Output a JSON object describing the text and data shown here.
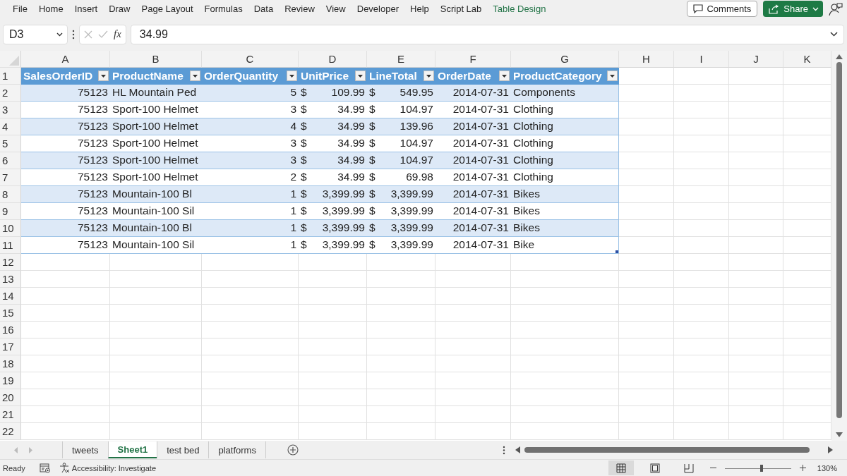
{
  "ribbon_tabs": [
    {
      "label": "File",
      "kind": "normal"
    },
    {
      "label": "Home",
      "kind": "normal"
    },
    {
      "label": "Insert",
      "kind": "normal"
    },
    {
      "label": "Draw",
      "kind": "normal"
    },
    {
      "label": "Page Layout",
      "kind": "normal"
    },
    {
      "label": "Formulas",
      "kind": "normal"
    },
    {
      "label": "Data",
      "kind": "normal"
    },
    {
      "label": "Review",
      "kind": "normal"
    },
    {
      "label": "View",
      "kind": "normal"
    },
    {
      "label": "Developer",
      "kind": "normal"
    },
    {
      "label": "Help",
      "kind": "normal"
    },
    {
      "label": "Script Lab",
      "kind": "normal"
    },
    {
      "label": "Table Design",
      "kind": "contextual"
    }
  ],
  "comments_button": "Comments",
  "share_button": "Share",
  "formula_bar": {
    "name_box": "D3",
    "function_label": "fx",
    "value": "34.99"
  },
  "columns": [
    "A",
    "B",
    "C",
    "D",
    "E",
    "F",
    "G",
    "H",
    "I",
    "J",
    "K"
  ],
  "table": {
    "header_row": "1",
    "headers": [
      "SalesOrderID",
      "ProductName",
      "OrderQuantity",
      "UnitPrice",
      "LineTotal",
      "OrderDate",
      "ProductCategory"
    ],
    "rows": [
      {
        "row": "2",
        "id": "75123",
        "product": "HL Mountain Ped",
        "qty": "5",
        "unit_price": {
          "symbol": "$",
          "amount": "109.99"
        },
        "line_total": {
          "symbol": "$",
          "amount": "549.95"
        },
        "date": "2014-07-31",
        "category": "Components"
      },
      {
        "row": "3",
        "id": "75123",
        "product": "Sport-100 Helmet",
        "qty": "3",
        "unit_price": {
          "symbol": "$",
          "amount": "34.99"
        },
        "line_total": {
          "symbol": "$",
          "amount": "104.97"
        },
        "date": "2014-07-31",
        "category": "Clothing"
      },
      {
        "row": "4",
        "id": "75123",
        "product": "Sport-100 Helmet",
        "qty": "4",
        "unit_price": {
          "symbol": "$",
          "amount": "34.99"
        },
        "line_total": {
          "symbol": "$",
          "amount": "139.96"
        },
        "date": "2014-07-31",
        "category": "Clothing"
      },
      {
        "row": "5",
        "id": "75123",
        "product": "Sport-100 Helmet",
        "qty": "3",
        "unit_price": {
          "symbol": "$",
          "amount": "34.99"
        },
        "line_total": {
          "symbol": "$",
          "amount": "104.97"
        },
        "date": "2014-07-31",
        "category": "Clothing"
      },
      {
        "row": "6",
        "id": "75123",
        "product": "Sport-100 Helmet",
        "qty": "3",
        "unit_price": {
          "symbol": "$",
          "amount": "34.99"
        },
        "line_total": {
          "symbol": "$",
          "amount": "104.97"
        },
        "date": "2014-07-31",
        "category": "Clothing"
      },
      {
        "row": "7",
        "id": "75123",
        "product": "Sport-100 Helmet",
        "qty": "2",
        "unit_price": {
          "symbol": "$",
          "amount": "34.99"
        },
        "line_total": {
          "symbol": "$",
          "amount": "69.98"
        },
        "date": "2014-07-31",
        "category": "Clothing"
      },
      {
        "row": "8",
        "id": "75123",
        "product": "Mountain-100 Bl",
        "qty": "1",
        "unit_price": {
          "symbol": "$",
          "amount": "3,399.99"
        },
        "line_total": {
          "symbol": "$",
          "amount": "3,399.99"
        },
        "date": "2014-07-31",
        "category": "Bikes"
      },
      {
        "row": "9",
        "id": "75123",
        "product": "Mountain-100 Sil",
        "qty": "1",
        "unit_price": {
          "symbol": "$",
          "amount": "3,399.99"
        },
        "line_total": {
          "symbol": "$",
          "amount": "3,399.99"
        },
        "date": "2014-07-31",
        "category": "Bikes"
      },
      {
        "row": "10",
        "id": "75123",
        "product": "Mountain-100 Bl",
        "qty": "1",
        "unit_price": {
          "symbol": "$",
          "amount": "3,399.99"
        },
        "line_total": {
          "symbol": "$",
          "amount": "3,399.99"
        },
        "date": "2014-07-31",
        "category": "Bikes"
      },
      {
        "row": "11",
        "id": "75123",
        "product": "Mountain-100 Sil",
        "qty": "1",
        "unit_price": {
          "symbol": "$",
          "amount": "3,399.99"
        },
        "line_total": {
          "symbol": "$",
          "amount": "3,399.99"
        },
        "date": "2014-07-31",
        "category": "Bike"
      }
    ]
  },
  "empty_rows": [
    "12",
    "13",
    "14",
    "15",
    "16",
    "17",
    "18",
    "19",
    "20",
    "21",
    "22"
  ],
  "sheet_tabs": [
    {
      "label": "tweets",
      "selected": false
    },
    {
      "label": "Sheet1",
      "selected": true
    },
    {
      "label": "test bed",
      "selected": false
    },
    {
      "label": "platforms",
      "selected": false
    }
  ],
  "status_bar": {
    "status": "Ready",
    "accessibility": "Accessibility: Investigate",
    "zoom": "130%",
    "zoom_slider": {
      "level": 0.56
    }
  },
  "view_buttons": [
    {
      "kind": "normal",
      "selected": true
    },
    {
      "kind": "page-layout",
      "selected": false
    },
    {
      "kind": "page-break",
      "selected": false
    }
  ]
}
